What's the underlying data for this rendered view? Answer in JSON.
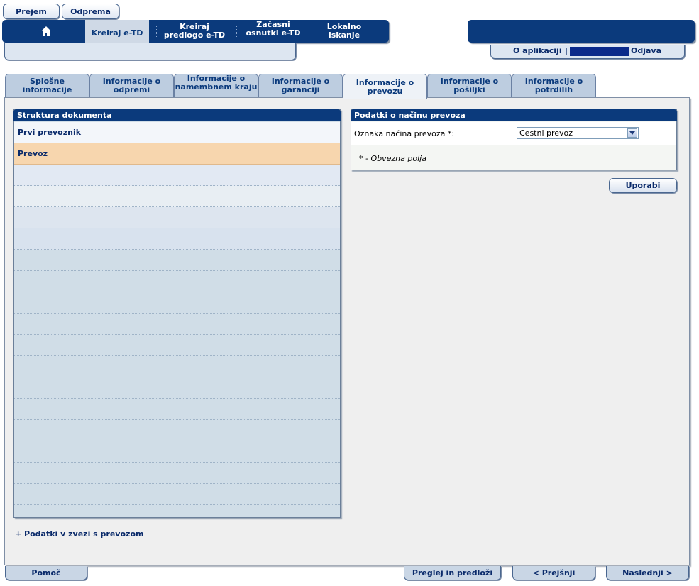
{
  "top_buttons": {
    "prejem": "Prejem",
    "odprema": "Odprema"
  },
  "nav": {
    "items": [
      {
        "label": "Kreiraj e-TD",
        "active": true
      },
      {
        "label": "Kreiraj predlogo e-TD"
      },
      {
        "label": "Začasni osnutki e-TD"
      },
      {
        "label": "Lokalno iskanje"
      }
    ]
  },
  "user_bar": {
    "about": "O aplikaciji",
    "separator": "|",
    "logout": "Odjava"
  },
  "tabs": [
    {
      "label": "Splošne informacije"
    },
    {
      "label": "Informacije o odpremi"
    },
    {
      "label": "Informacije o namembnem kraju"
    },
    {
      "label": "Informacije o garanciji"
    },
    {
      "label": "Informacije o prevozu",
      "active": true
    },
    {
      "label": "Informacije o pošiljki"
    },
    {
      "label": "Informacije o potrdilih"
    }
  ],
  "structure": {
    "title": "Struktura dokumenta",
    "items": [
      {
        "label": "Prvi prevoznik"
      },
      {
        "label": "Prevoz",
        "selected": true
      }
    ],
    "add_link": "+ Podatki v zvezi s prevozom"
  },
  "form": {
    "title": "Podatki o načinu prevoza",
    "field_label": "Oznaka načina prevoza *:",
    "field_value": "Cestni prevoz",
    "required_note": "* - Obvezna polja",
    "apply_button": "Uporabi"
  },
  "footer": {
    "help": "Pomoč",
    "review": "Preglej in predloži",
    "prev": "< Prejšnji",
    "next": "Naslednji >"
  },
  "colors": {
    "nav_bg": "#0b3a7c",
    "selected_row": "#f7d6ae",
    "tab_bg": "#bdcde0"
  }
}
